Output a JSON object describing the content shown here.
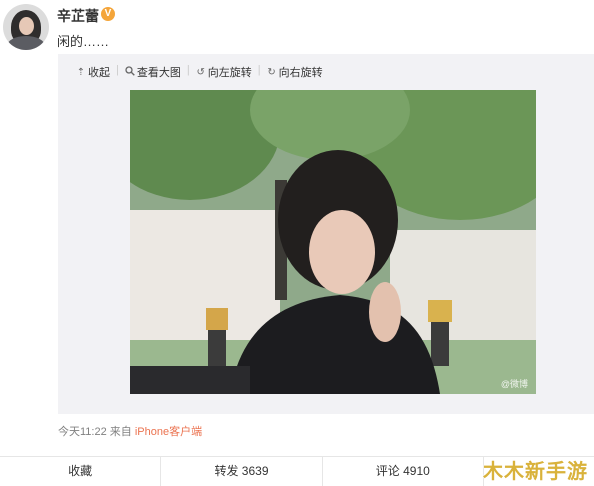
{
  "user": {
    "name": "辛芷蕾",
    "verified_badge": "V"
  },
  "post": {
    "text": "闲的……"
  },
  "toolbar": {
    "collapse": "收起",
    "view_large": "查看大图",
    "rotate_left": "向左旋转",
    "rotate_right": "向右旋转"
  },
  "photo": {
    "watermark": "@微博"
  },
  "meta": {
    "time": "今天11:22",
    "from_label": "来自",
    "source": "iPhone客户端"
  },
  "actions": {
    "favorite": "收藏",
    "repost": "转发 3639",
    "comment": "评论 4910",
    "like": ""
  },
  "site_watermark": "木木新手游",
  "colors": {
    "accent": "#eb7350",
    "badge": "#f4a53a",
    "media_bg": "#f2f2f5"
  }
}
